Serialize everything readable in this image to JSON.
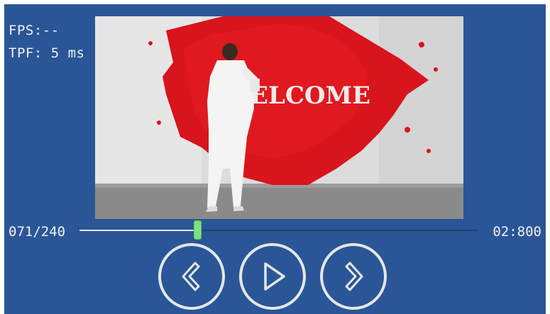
{
  "stats": {
    "fps": "FPS:--",
    "tpf": "TPF: 5 ms"
  },
  "video": {
    "overlay_text": "ELCOME"
  },
  "playback": {
    "frame_counter": "071/240",
    "time": "02:800",
    "current_frame": 71,
    "total_frames": 240
  },
  "controls": {
    "prev_icon": "chevron-left-icon",
    "play_icon": "play-icon",
    "next_icon": "chevron-right-icon"
  },
  "colors": {
    "background": "#2a5697",
    "text": "#f2f2f2",
    "progress_fill": "#e6e6e6",
    "progress_thumb": "#7fe07f",
    "button_outline": "#e6e6e6"
  }
}
